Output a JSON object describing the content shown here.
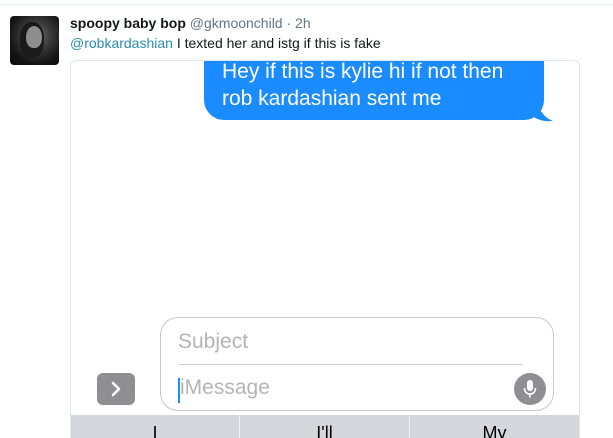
{
  "tweet": {
    "display_name": "spoopy baby bop",
    "handle": "@gkmoonchild",
    "separator": "·",
    "time": "2h",
    "mention": "@robkardashian",
    "text": " I texted her and istg if this is fake"
  },
  "imessage": {
    "bubble_line1": "Hey if this is kylie hi if not then",
    "bubble_line2": "rob kardashian sent me",
    "bubble_color": "#1a8cff",
    "subject_placeholder": "Subject",
    "message_placeholder": "iMessage",
    "keyboard_keys": [
      "I",
      "I'll",
      "My"
    ]
  }
}
